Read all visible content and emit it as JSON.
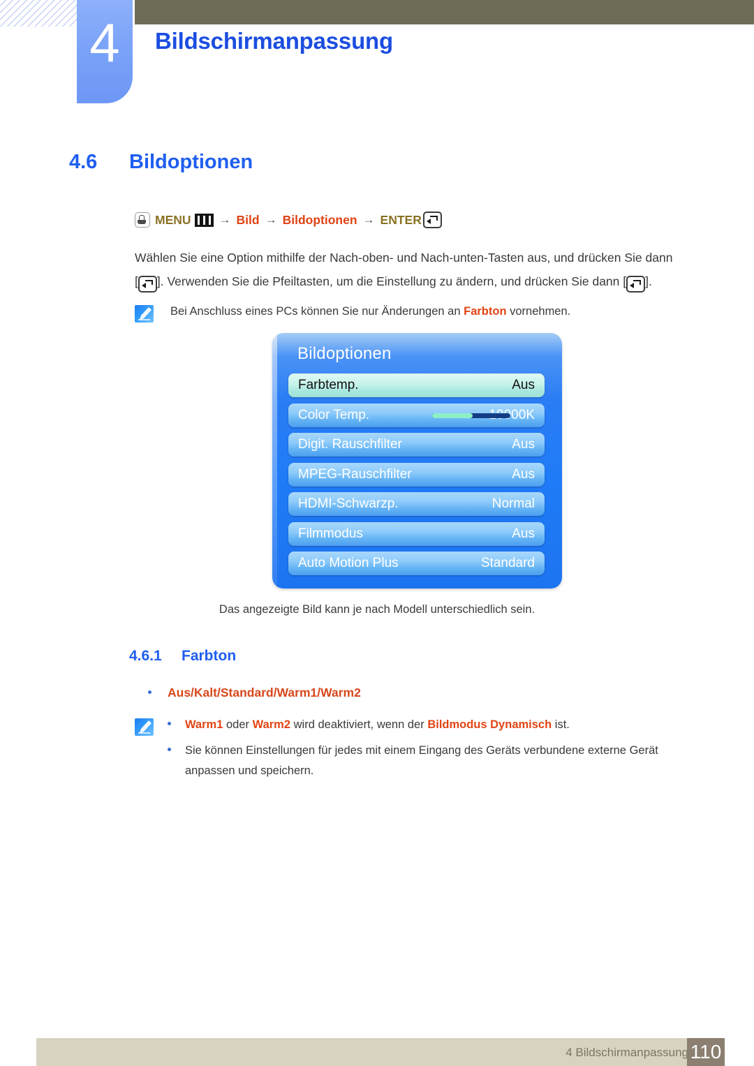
{
  "header": {
    "chapter_number": "4",
    "chapter_title": "Bildschirmanpassung"
  },
  "section": {
    "number": "4.6",
    "title": "Bildoptionen"
  },
  "menu_path": {
    "hand_icon": "hand-press-icon",
    "menu_label": "MENU",
    "menu_icon": "menu-bars-icon",
    "arrow1": "→",
    "item1": "Bild",
    "arrow2": "→",
    "item2": "Bildoptionen",
    "arrow3": "→",
    "enter_label": "ENTER",
    "enter_icon": "enter-key-icon"
  },
  "instructions": {
    "line1": "Wählen Sie eine Option mithilfe der Nach-oben- und Nach-unten-Tasten aus, und drücken Sie dann",
    "line2_pre": "[",
    "line2_mid": "]. Verwenden Sie die Pfeiltasten, um die Einstellung zu ändern, und drücken Sie dann [",
    "line2_post": "]."
  },
  "note1": {
    "icon": "note-pen-icon",
    "text_before": "Bei Anschluss eines PCs können Sie nur Änderungen an ",
    "highlight": "Farbton",
    "text_after": " vornehmen."
  },
  "osd": {
    "title": "Bildoptionen",
    "rows": [
      {
        "label": "Farbtemp.",
        "value": "Aus",
        "selected": true,
        "has_slider": false
      },
      {
        "label": "Color Temp.",
        "value": "10000K",
        "selected": false,
        "has_slider": true,
        "slider_percent": 52
      },
      {
        "label": "Digit. Rauschfilter",
        "value": "Aus",
        "selected": false,
        "has_slider": false
      },
      {
        "label": "MPEG-Rauschfilter",
        "value": "Aus",
        "selected": false,
        "has_slider": false
      },
      {
        "label": "HDMI-Schwarzp.",
        "value": "Normal",
        "selected": false,
        "has_slider": false
      },
      {
        "label": "Filmmodus",
        "value": "Aus",
        "selected": false,
        "has_slider": false
      },
      {
        "label": "Auto Motion Plus",
        "value": "Standard",
        "selected": false,
        "has_slider": false
      }
    ],
    "caption": "Das angezeigte Bild kann je nach Modell unterschiedlich sein."
  },
  "subsection": {
    "number": "4.6.1",
    "title": "Farbton"
  },
  "options_bullet": {
    "options": [
      "Aus",
      "Kalt",
      "Standard",
      "Warm1",
      "Warm2"
    ],
    "text": "Aus/Kalt/Standard/Warm1/Warm2"
  },
  "note2": {
    "icon": "note-pen-icon",
    "item1": {
      "hl1": "Warm1",
      "mid1": " oder ",
      "hl2": "Warm2",
      "mid2": " wird deaktiviert, wenn der ",
      "hl3": "Bildmodus Dynamisch",
      "tail": " ist."
    },
    "item2": "Sie können Einstellungen für jedes mit einem Eingang des Geräts verbundene externe Gerät anpassen und speichern."
  },
  "footer": {
    "label": "4 Bildschirmanpassung",
    "page": "110"
  },
  "colors": {
    "accent_blue": "#1f5ef0",
    "highlight_orange": "#e24414",
    "menu_gold": "#8a7224",
    "olive_bar": "#6e6c57",
    "footer_bar": "#d8d3c1",
    "footer_page_box": "#8b7f71",
    "osd_blue": "#1f7bf7",
    "osd_selected": "#c6f2ea"
  }
}
